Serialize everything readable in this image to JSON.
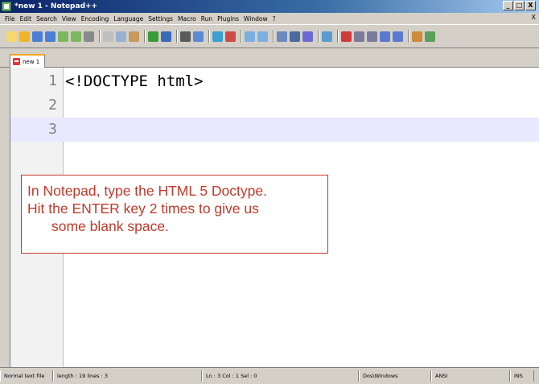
{
  "window": {
    "title": "*new 1 - Notepad++",
    "controls": {
      "minimize": "_",
      "maximize": "□",
      "close": "X"
    }
  },
  "menubar": {
    "items": [
      "File",
      "Edit",
      "Search",
      "View",
      "Encoding",
      "Language",
      "Settings",
      "Macro",
      "Run",
      "Plugins",
      "Window",
      "?"
    ],
    "close_label": "X"
  },
  "toolbar": {
    "icons": [
      {
        "name": "new-file-icon",
        "color": "#f5d76e"
      },
      {
        "name": "open-file-icon",
        "color": "#f0b429"
      },
      {
        "name": "save-icon",
        "color": "#4a7fd4"
      },
      {
        "name": "save-all-icon",
        "color": "#4a7fd4"
      },
      {
        "name": "close-icon",
        "color": "#7bb661"
      },
      {
        "name": "close-all-icon",
        "color": "#7bb661"
      },
      {
        "name": "print-icon",
        "color": "#8a8a8a"
      },
      {
        "name": "cut-icon",
        "color": "#c0c0c0"
      },
      {
        "name": "copy-icon",
        "color": "#9ab0d0"
      },
      {
        "name": "paste-icon",
        "color": "#c89a5a"
      },
      {
        "name": "undo-icon",
        "color": "#3a9a3a"
      },
      {
        "name": "redo-icon",
        "color": "#3a6aba"
      },
      {
        "name": "find-icon",
        "color": "#5a5a5a"
      },
      {
        "name": "replace-icon",
        "color": "#5a8ad0"
      },
      {
        "name": "zoom-in-icon",
        "color": "#3aa0d0"
      },
      {
        "name": "zoom-out-icon",
        "color": "#d04a4a"
      },
      {
        "name": "sync-vertical-icon",
        "color": "#7ab0e0"
      },
      {
        "name": "sync-horizontal-icon",
        "color": "#7ab0e0"
      },
      {
        "name": "word-wrap-icon",
        "color": "#6a8ac0"
      },
      {
        "name": "all-chars-icon",
        "color": "#4a6aa0"
      },
      {
        "name": "indent-guide-icon",
        "color": "#6a6ad0"
      },
      {
        "name": "user-lang-icon",
        "color": "#5a9ad0"
      },
      {
        "name": "record-macro-icon",
        "color": "#d03a3a"
      },
      {
        "name": "stop-macro-icon",
        "color": "#7a7a9a"
      },
      {
        "name": "play-macro-icon",
        "color": "#7a7a9a"
      },
      {
        "name": "run-macro-icon",
        "color": "#5a7ad0"
      },
      {
        "name": "save-macro-icon",
        "color": "#5a7ad0"
      },
      {
        "name": "lang-icon",
        "color": "#d08a3a"
      },
      {
        "name": "spell-check-icon",
        "color": "#5aa05a"
      }
    ]
  },
  "tabs": [
    {
      "label": "new 1"
    }
  ],
  "editor": {
    "lines": [
      {
        "number": "1",
        "text": "<!DOCTYPE html>"
      },
      {
        "number": "2",
        "text": ""
      },
      {
        "number": "3",
        "text": ""
      }
    ],
    "current_line_color": "#e8e8ff"
  },
  "callout": {
    "lines": [
      "In Notepad, type the HTML 5 Doctype.",
      "Hit the ENTER key 2 times to give us",
      "some blank space."
    ],
    "color": "#c0392b"
  },
  "statusbar": {
    "file_type": "Normal text file",
    "length_lines": "length : 19   lines : 3",
    "position": "Ln : 3   Col : 1   Sel : 0",
    "eol": "Dos\\Windows",
    "encoding": "ANSI",
    "mode": "INS"
  }
}
